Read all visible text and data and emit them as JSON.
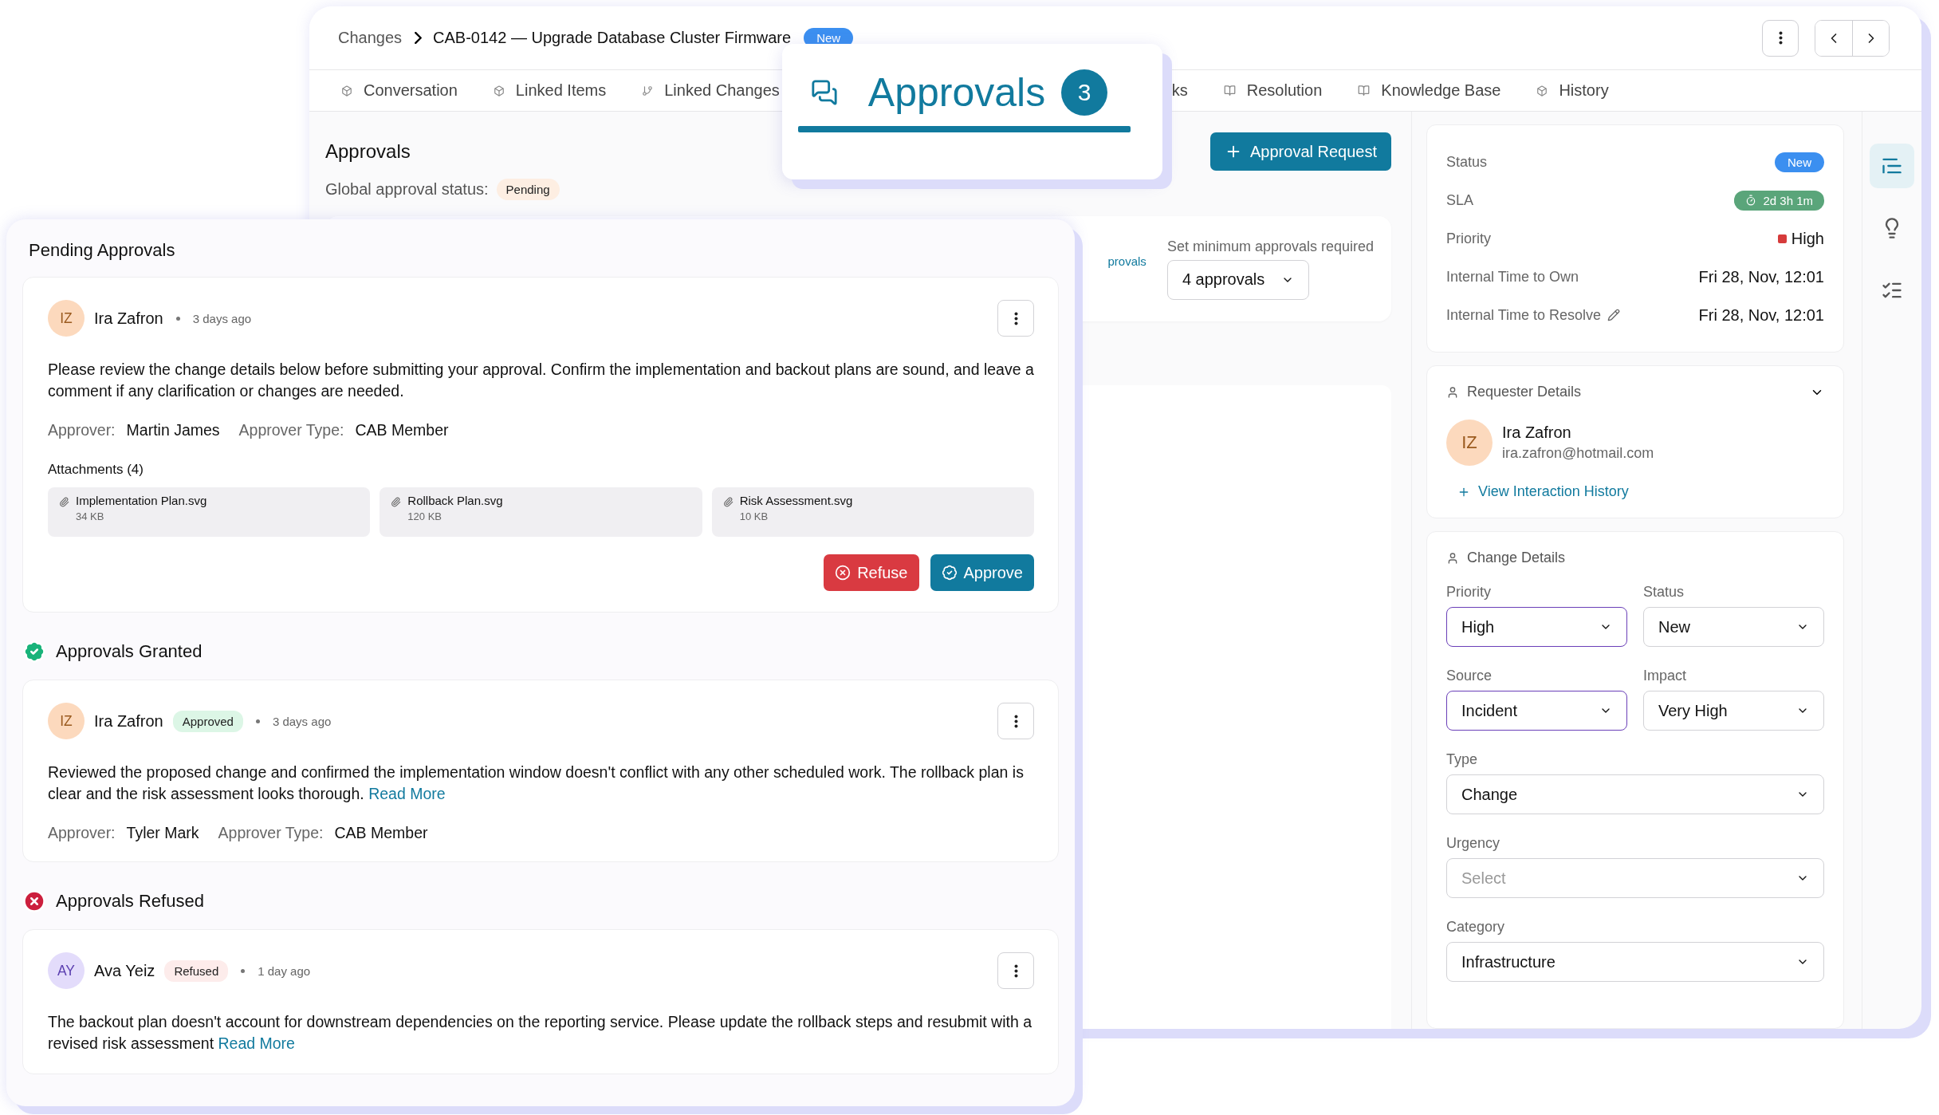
{
  "breadcrumb": {
    "parent": "Changes",
    "title": "CAB-0142 — Upgrade Database Cluster Firmware",
    "badge": "New"
  },
  "tabs": [
    {
      "label": "Conversation",
      "kind": "box",
      "selected": false
    },
    {
      "label": "Linked Items",
      "kind": "box",
      "selected": false
    },
    {
      "label": "Linked Changes",
      "kind": "branch",
      "selected": false
    },
    {
      "label": "Approvals",
      "kind": "chat",
      "count": "3",
      "selected": true
    },
    {
      "label": "ks",
      "kind": "cut",
      "selected": false
    },
    {
      "label": "Resolution",
      "kind": "book",
      "selected": false
    },
    {
      "label": "Knowledge Base",
      "kind": "book",
      "selected": false
    },
    {
      "label": "History",
      "kind": "box",
      "selected": false
    }
  ],
  "approvals": {
    "title": "Approvals",
    "status_label": "Global approval status:",
    "status": "Pending",
    "request_button": "Approval Request"
  },
  "minimum": {
    "cut_label": "provals",
    "label": "Set minimum approvals required",
    "value": "4 approvals"
  },
  "summary": [
    {
      "label": "Status",
      "value": "New",
      "kind": "badge"
    },
    {
      "label": "SLA",
      "value": "2d 3h 1m",
      "kind": "timer"
    },
    {
      "label": "Priority",
      "value": "High",
      "kind": "priority",
      "color": "#d63b3b"
    },
    {
      "label": "Internal Time to Own",
      "value": "Fri 28, Nov, 12:01",
      "kind": "text"
    },
    {
      "label": "Internal Time to Resolve",
      "value": "Fri 28, Nov, 12:01",
      "kind": "editable"
    }
  ],
  "requester": {
    "title": "Requester Details",
    "initials": "IZ",
    "name": "Ira Zafron",
    "email": "ira.zafron@hotmail.com",
    "link": "View Interaction History"
  },
  "change_details": {
    "title": "Change Details",
    "fields": [
      {
        "label": "Priority",
        "value": "High",
        "highlighted": true,
        "kind": "half"
      },
      {
        "label": "Status",
        "value": "New",
        "highlighted": false,
        "kind": "half"
      },
      {
        "label": "Source",
        "value": "Incident",
        "highlighted": true,
        "kind": "half"
      },
      {
        "label": "Impact",
        "value": "Very High",
        "highlighted": false,
        "kind": "half"
      },
      {
        "label": "Type",
        "value": "Change",
        "highlighted": false,
        "kind": "full"
      },
      {
        "label": "Urgency",
        "placeholder": "Select",
        "highlighted": false,
        "kind": "full"
      },
      {
        "label": "Category",
        "value": "Infrastructure",
        "highlighted": false,
        "kind": "full"
      }
    ]
  },
  "rail": [
    {
      "kind": "details",
      "selected": true
    },
    {
      "kind": "ideas",
      "selected": false
    },
    {
      "kind": "checklist",
      "selected": false
    }
  ],
  "pending": {
    "title": "Pending Approvals",
    "items": [
      {
        "initials": "IZ",
        "color": "#fcd9bd",
        "name": "Ira Zafron",
        "time": "3 days ago",
        "text": "Please review the change details below before submitting your approval. Confirm the implementation and backout plans are sound, and leave a comment if any clarification or changes are needed.",
        "approver_label": "Approver:",
        "approver": "Martin James",
        "type_label": "Approver Type:",
        "type": "CAB Member",
        "attachments_title": "Attachments (4)",
        "attachments": [
          {
            "name": "Implementation Plan.svg",
            "size": "34 KB"
          },
          {
            "name": "Rollback Plan.svg",
            "size": "120 KB"
          },
          {
            "name": "Risk Assessment.svg",
            "size": "10 KB"
          }
        ],
        "refuse": "Refuse",
        "approve": "Approve"
      }
    ]
  },
  "sections": [
    {
      "kind": "granted",
      "title": "Approvals Granted",
      "items": [
        {
          "initials": "IZ",
          "color": "#fcd9bd",
          "name": "Ira Zafron",
          "badge": "Approved",
          "time": "3 days ago",
          "text": "Reviewed the proposed change and confirmed the implementation window doesn't conflict with any other scheduled work. The rollback plan is clear and the risk assessment looks thorough.",
          "link": "Read More",
          "approver_label": "Approver:",
          "approver": "Tyler Mark",
          "type_label": "Approver Type:",
          "type": "CAB Member"
        }
      ]
    },
    {
      "kind": "refused",
      "title": "Approvals Refused",
      "items": [
        {
          "initials": "AY",
          "color": "#e3dcfb",
          "name": "Ava Yeiz",
          "badge": "Refused",
          "time": "1 day ago",
          "text": "The backout plan doesn't account for downstream dependencies on the reporting service. Please update the rollback steps and resubmit with a revised risk assessment",
          "link": "Read More"
        }
      ]
    }
  ]
}
